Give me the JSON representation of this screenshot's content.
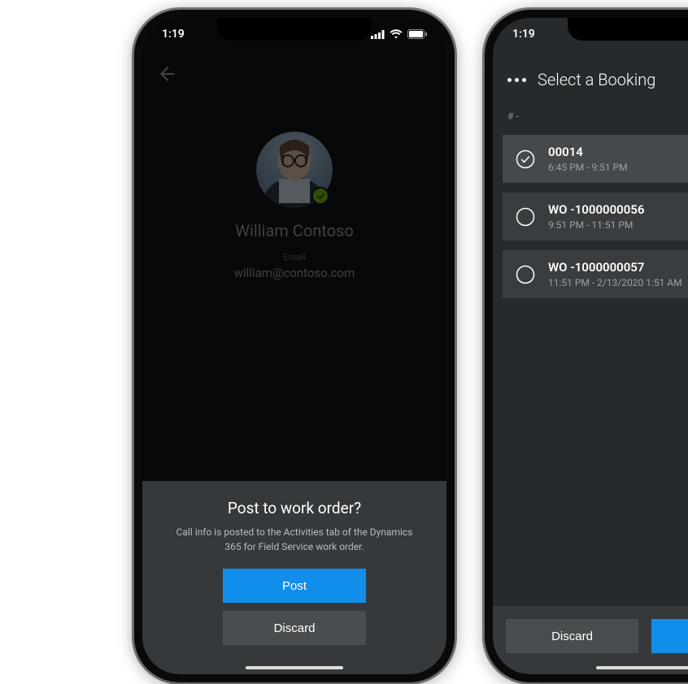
{
  "status": {
    "time": "1:19"
  },
  "left": {
    "contact": {
      "name": "William Contoso",
      "email_label": "Email",
      "email": "william@contoso.com"
    },
    "sheet": {
      "title": "Post to work order?",
      "description": "Call info is posted to the Activities tab of the Dynamics 365 for Field Service work order.",
      "post_label": "Post",
      "discard_label": "Discard"
    }
  },
  "right": {
    "header_title": "Select a Booking",
    "section_heading": "# -",
    "bookings": [
      {
        "selected": true,
        "title": "00014",
        "time": "6:45 PM - 9:51 PM"
      },
      {
        "selected": false,
        "title": "WO -1000000056",
        "time": "9:51 PM - 11:51 PM"
      },
      {
        "selected": false,
        "title": "WO -1000000057",
        "time": "11:51 PM - 2/13/2020 1:51 AM"
      }
    ],
    "footer": {
      "discard_label": "Discard"
    }
  }
}
